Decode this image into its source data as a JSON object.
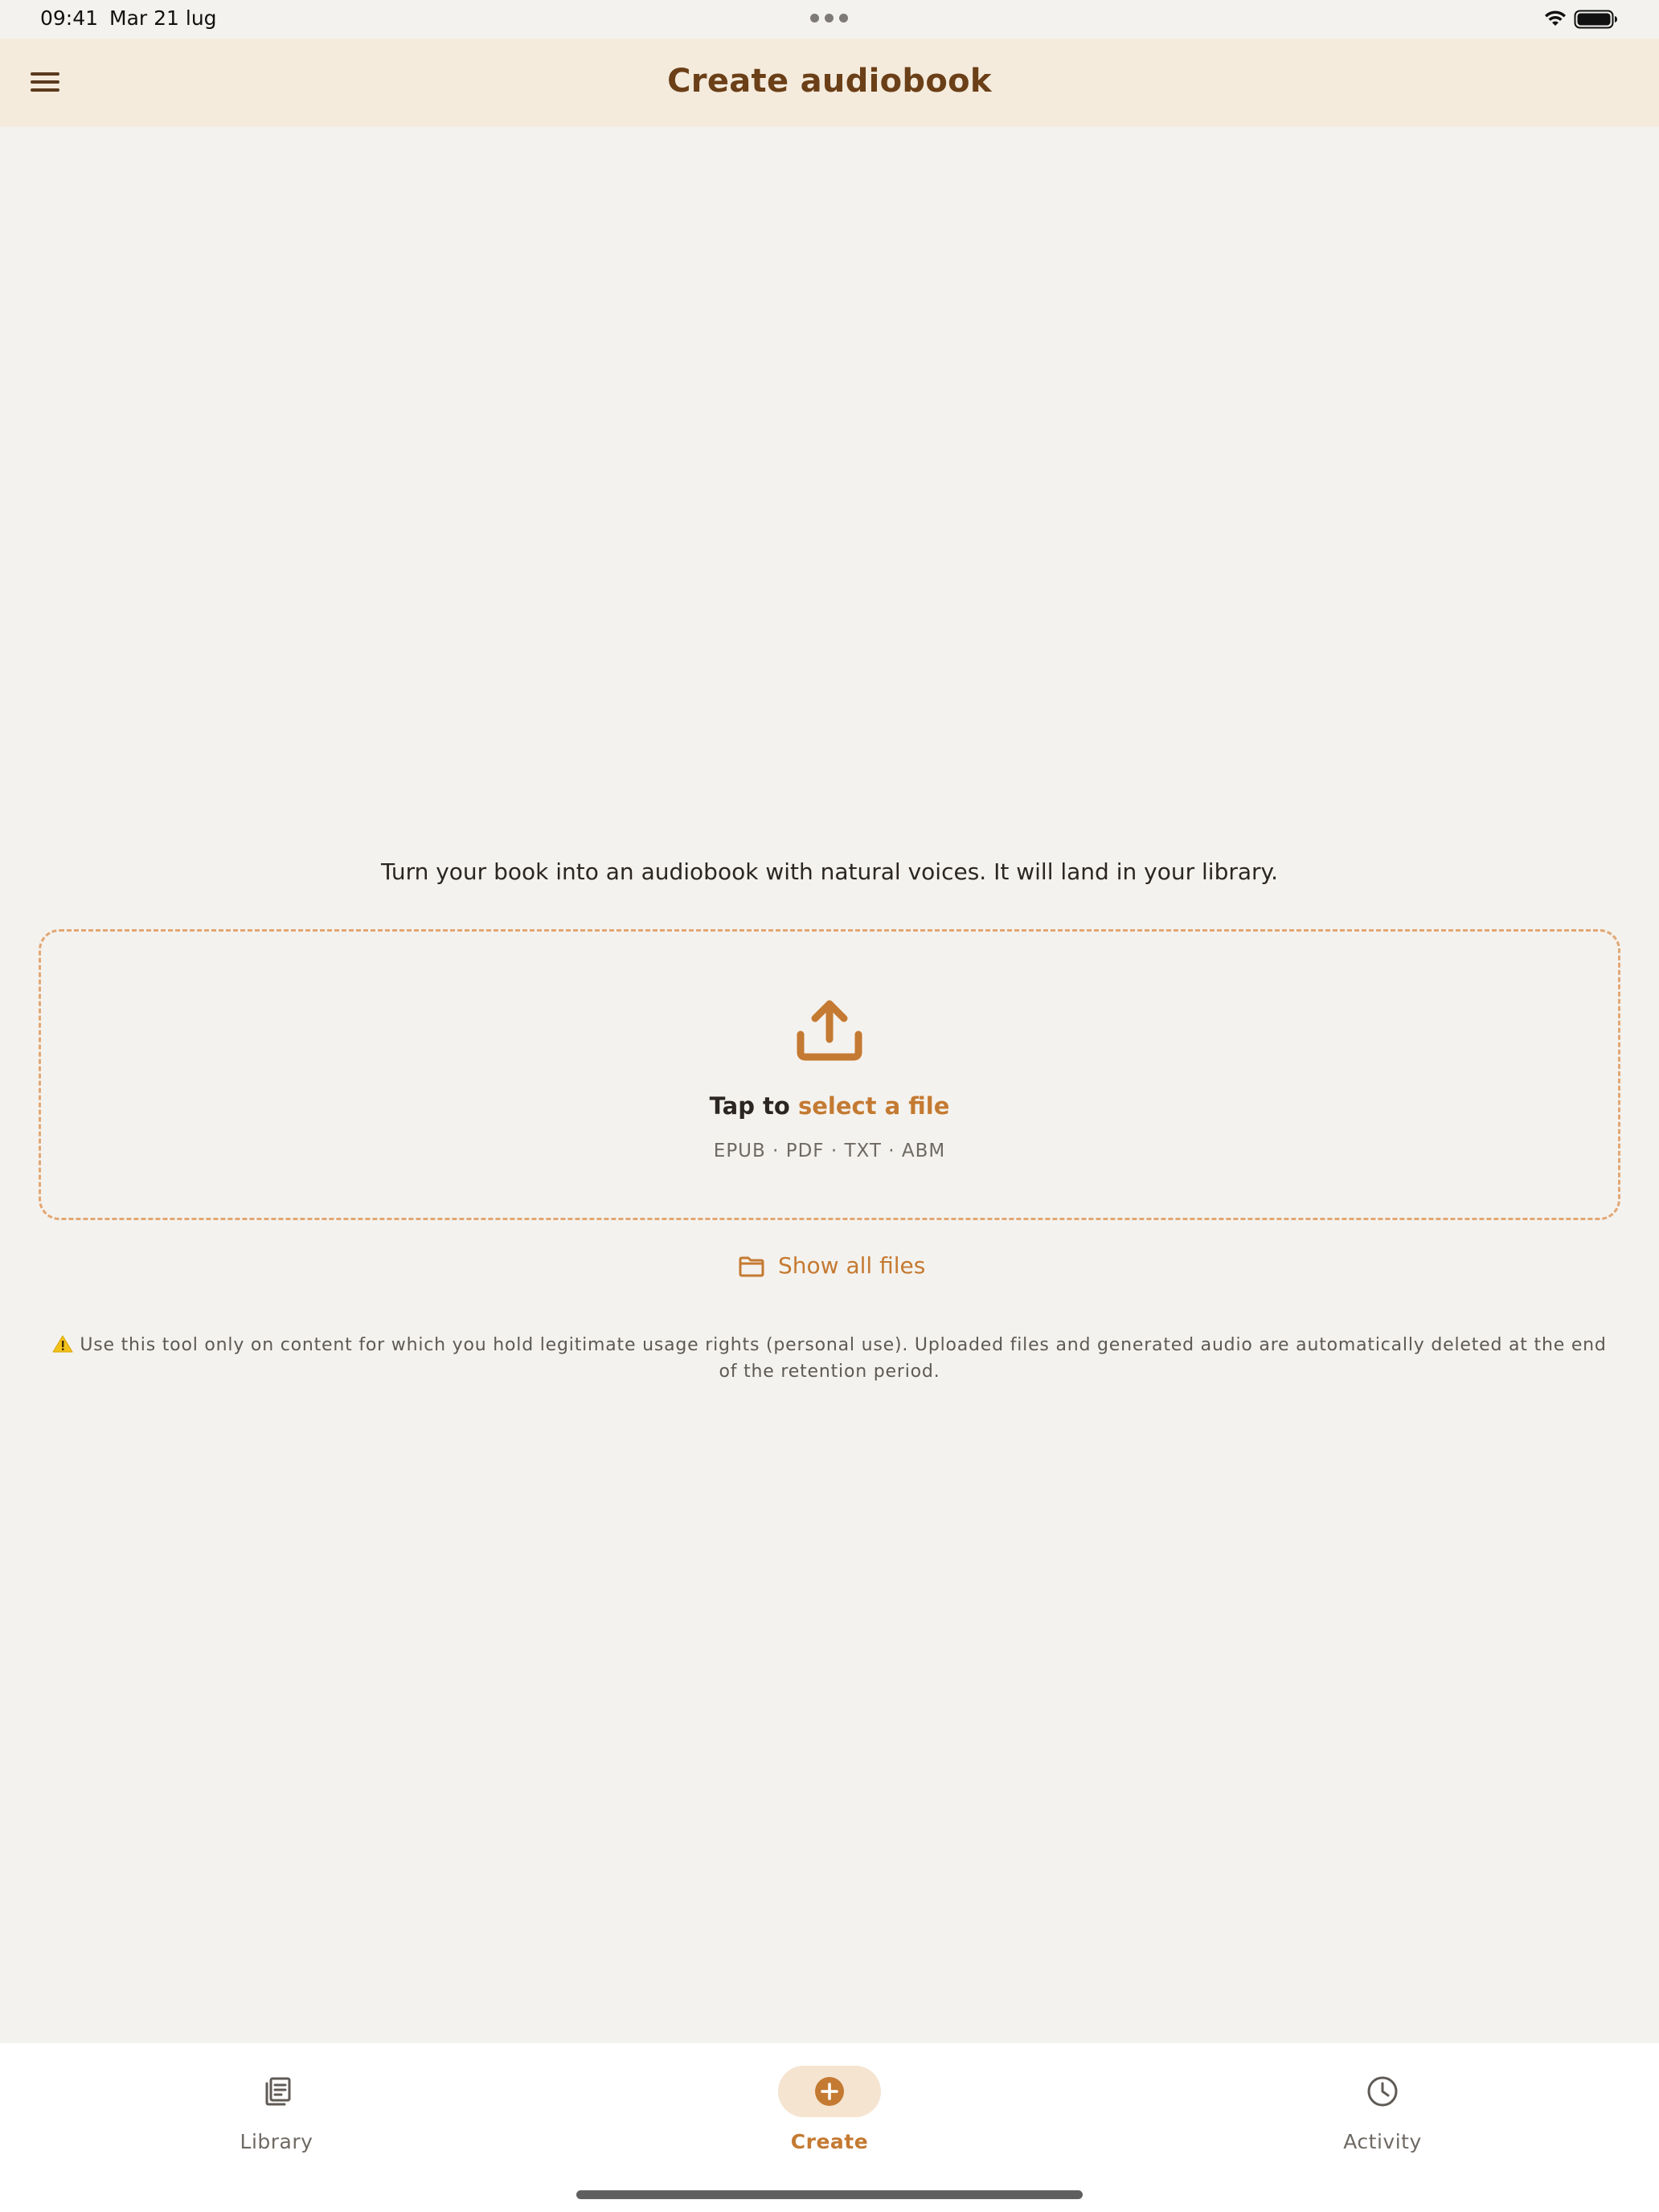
{
  "status_bar": {
    "time": "09:41",
    "date": "Mar 21 lug",
    "icons": [
      "more-dots-icon",
      "wifi-icon",
      "battery-icon"
    ]
  },
  "app_bar": {
    "title": "Create audiobook",
    "menu_icon": "menu-icon"
  },
  "main": {
    "intro": "Turn your book into an audiobook with natural voices. It will land in your library.",
    "dropzone": {
      "icon": "upload-icon",
      "tap_prefix": "Tap to",
      "tap_link": "select a file",
      "formats": "EPUB · PDF · TXT · ABM"
    },
    "show_all_files": {
      "icon": "folder-icon",
      "label": "Show all files"
    },
    "notice": {
      "icon": "warning-icon",
      "text": "Use this tool only on content for which you hold legitimate usage rights (personal use). Uploaded files and generated audio are automatically deleted at the end of the retention period."
    }
  },
  "bottom_nav": {
    "items": [
      {
        "label": "Library",
        "icon": "library-icon",
        "active": false
      },
      {
        "label": "Create",
        "icon": "add-circle-icon",
        "active": true
      },
      {
        "label": "Activity",
        "icon": "clock-icon",
        "active": false
      }
    ]
  },
  "colors": {
    "background": "#f4f2ee",
    "app_bar": "#f4ebdd",
    "title": "#6b3f17",
    "accent": "#c47a32",
    "dashed_border": "#e2a774",
    "active_pill": "#f5e4d0"
  }
}
